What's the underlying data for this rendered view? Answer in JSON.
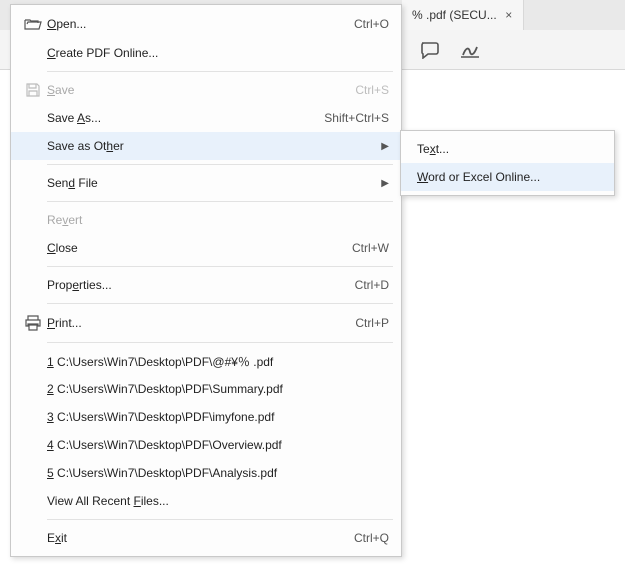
{
  "tab": {
    "label": "% .pdf (SECU...",
    "close": "×"
  },
  "menu": {
    "open": {
      "pre": "",
      "u": "O",
      "post": "pen...",
      "accel": "Ctrl+O"
    },
    "createPdfOnline": {
      "pre": "",
      "u": "C",
      "post": "reate PDF Online..."
    },
    "save": {
      "pre": "",
      "u": "S",
      "post": "ave",
      "accel": "Ctrl+S"
    },
    "saveAs": {
      "pre": "Save ",
      "u": "A",
      "post": "s...",
      "accel": "Shift+Ctrl+S"
    },
    "saveAsOther": {
      "pre": "Save as Ot",
      "u": "h",
      "post": "er"
    },
    "sendFile": {
      "pre": "Sen",
      "u": "d",
      "post": " File"
    },
    "revert": {
      "pre": "Re",
      "u": "v",
      "post": "ert"
    },
    "close": {
      "pre": "",
      "u": "C",
      "post": "lose",
      "accel": "Ctrl+W"
    },
    "properties": {
      "pre": "Prop",
      "u": "e",
      "post": "rties...",
      "accel": "Ctrl+D"
    },
    "print": {
      "pre": "",
      "u": "P",
      "post": "rint...",
      "accel": "Ctrl+P"
    },
    "recent": [
      {
        "u": "1",
        "path": " C:\\Users\\Win7\\Desktop\\PDF\\@#¥％ .pdf"
      },
      {
        "u": "2",
        "path": " C:\\Users\\Win7\\Desktop\\PDF\\Summary.pdf"
      },
      {
        "u": "3",
        "path": " C:\\Users\\Win7\\Desktop\\PDF\\imyfone.pdf"
      },
      {
        "u": "4",
        "path": " C:\\Users\\Win7\\Desktop\\PDF\\Overview.pdf"
      },
      {
        "u": "5",
        "path": " C:\\Users\\Win7\\Desktop\\PDF\\Analysis.pdf"
      }
    ],
    "viewAllRecent": {
      "pre": "View All Recent ",
      "u": "F",
      "post": "iles..."
    },
    "exit": {
      "pre": "E",
      "u": "x",
      "post": "it",
      "accel": "Ctrl+Q"
    }
  },
  "submenu": {
    "text": {
      "pre": "Te",
      "u": "x",
      "post": "t..."
    },
    "wordExcel": {
      "pre": "",
      "u": "W",
      "post": "ord or Excel Online..."
    }
  }
}
